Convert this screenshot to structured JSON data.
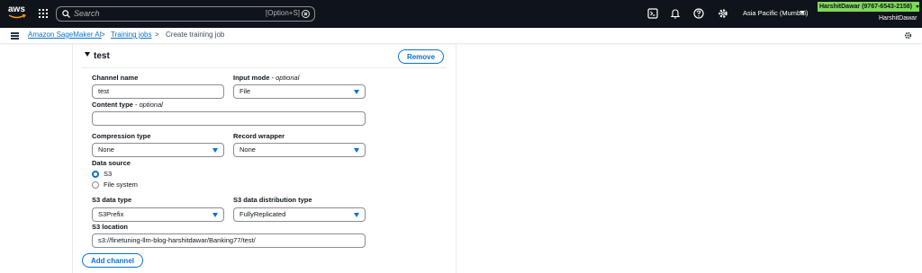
{
  "topbar": {
    "logo_text": "aws",
    "search_placeholder": "Search",
    "search_shortcut": "[Option+S]",
    "region": "Asia Pacific (Mumbai)",
    "account_badge": "HarshitDawar (9767-6543-2158)",
    "username": "HarshitDawar",
    "icons": [
      "cloudshell-icon",
      "bell-icon",
      "help-icon",
      "gear-icon"
    ]
  },
  "breadcrumb": {
    "items": [
      "Amazon SageMaker AI",
      "Training jobs",
      "Create training job"
    ],
    "separator": ">"
  },
  "channel": {
    "title": "test",
    "remove_label": "Remove",
    "channel_name_label": "Channel name",
    "channel_name_value": "test",
    "input_mode_label": "Input mode",
    "input_mode_optional": " - optional",
    "input_mode_value": "File",
    "content_type_label": "Content type",
    "content_type_optional": " - optional",
    "content_type_value": "",
    "compression_label": "Compression type",
    "compression_value": "None",
    "record_wrapper_label": "Record wrapper",
    "record_wrapper_value": "None",
    "data_source_label": "Data source",
    "data_source_options": [
      "S3",
      "File system"
    ],
    "data_source_selected": "S3",
    "s3_data_type_label": "S3 data type",
    "s3_data_type_value": "S3Prefix",
    "s3_distribution_label": "S3 data distribution type",
    "s3_distribution_value": "FullyReplicated",
    "s3_location_label": "S3 location",
    "s3_location_value": "s3://finetuning-llm-blog-harshitdawar/Banking77/test/"
  },
  "add_channel_label": "Add channel",
  "colors": {
    "topbar_bg": "#0f141a",
    "accent": "#0972d3",
    "account_badge": "#7ed957"
  }
}
